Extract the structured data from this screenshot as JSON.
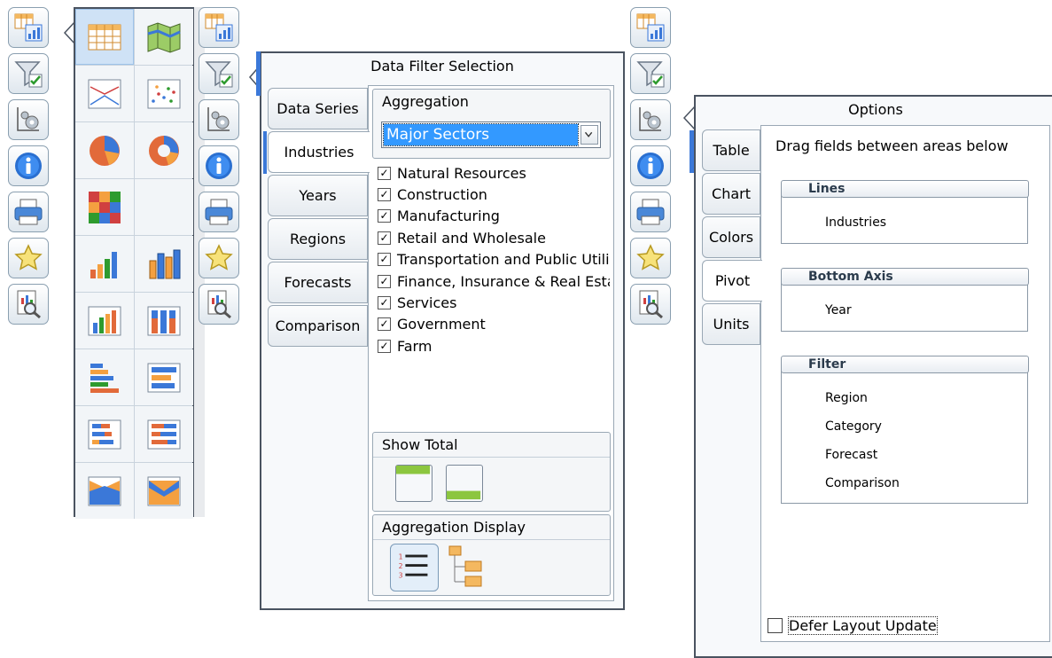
{
  "toolbar_icons": [
    "table-chart-icon",
    "filter-icon",
    "settings-icon",
    "info-icon",
    "print-icon",
    "favorite-star-icon",
    "zoom-report-icon"
  ],
  "chart_picker": [
    "grid-table",
    "map",
    "line-chart",
    "scatter-chart",
    "pie-chart",
    "donut-chart",
    "heatmap",
    "",
    "bar-chart",
    "bar-3d-chart",
    "column-chart",
    "stacked-column-chart",
    "horizontal-bar-chart",
    "horizontal-3d-bar-chart",
    "stacked-horizontal-bar",
    "stacked-horizontal-bar-2",
    "area-chart",
    "stacked-area-chart"
  ],
  "data_filter": {
    "title": "Data Filter Selection",
    "tabs": [
      "Data Series",
      "Industries",
      "Years",
      "Regions",
      "Forecasts",
      "Comparison"
    ],
    "active_tab": "Industries",
    "aggregation": {
      "label": "Aggregation",
      "selected": "Major Sectors"
    },
    "items": [
      {
        "label": "Natural Resources",
        "checked": true
      },
      {
        "label": "Construction",
        "checked": true
      },
      {
        "label": "Manufacturing",
        "checked": true
      },
      {
        "label": "Retail and Wholesale",
        "checked": true
      },
      {
        "label": "Transportation and Public Utilities",
        "checked": true
      },
      {
        "label": "Finance, Insurance & Real Estate",
        "checked": true
      },
      {
        "label": "Services",
        "checked": true
      },
      {
        "label": "Government",
        "checked": true
      },
      {
        "label": "Farm",
        "checked": true
      }
    ],
    "show_total": {
      "label": "Show Total"
    },
    "aggregation_display": {
      "label": "Aggregation Display"
    }
  },
  "options": {
    "title": "Options",
    "tabs": [
      "Table",
      "Chart",
      "Colors",
      "Pivot",
      "Units"
    ],
    "active_tab": "Pivot",
    "instruction": "Drag fields between areas below",
    "areas": {
      "lines": {
        "label": "Lines",
        "fields": [
          "Industries"
        ]
      },
      "bottom_axis": {
        "label": "Bottom Axis",
        "fields": [
          "Year"
        ]
      },
      "filter": {
        "label": "Filter",
        "fields": [
          "Region",
          "Category",
          "Forecast",
          "Comparison"
        ]
      }
    },
    "defer_label": "Defer Layout Update"
  },
  "colors": {
    "selected_blue": "#3399ff",
    "accent_blue": "#3b78d8",
    "green": "#8cc63f",
    "orange": "#f4a040"
  }
}
